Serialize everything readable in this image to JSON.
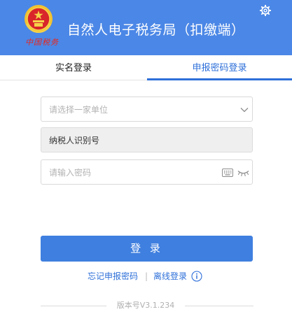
{
  "header": {
    "logo_text": "中国税务",
    "title": "自然人电子税务局（扣缴端）",
    "icons": {
      "emblem": "national-emblem-icon",
      "settings": "gear-icon"
    }
  },
  "tabs": [
    {
      "label": "实名登录",
      "active": false
    },
    {
      "label": "申报密码登录",
      "active": true
    }
  ],
  "form": {
    "unit_select": {
      "placeholder": "请选择一家单位",
      "icon": "chevron-down-icon"
    },
    "taxpayer_id": {
      "value": "纳税人识别号"
    },
    "password": {
      "placeholder": "请输入密码",
      "icons": [
        "keyboard-icon",
        "eye-closed-icon"
      ]
    }
  },
  "login_button": {
    "label": "登 录"
  },
  "links": {
    "forgot": "忘记申报密码",
    "separator": "|",
    "offline": "离线登录",
    "info_icon": "info-icon"
  },
  "version": "版本号V3.1.234",
  "colors": {
    "header_bg": "#4b87e6",
    "accent": "#2d6fd9",
    "button_bg": "#3f7fdf",
    "logo_red": "#e9271d"
  }
}
